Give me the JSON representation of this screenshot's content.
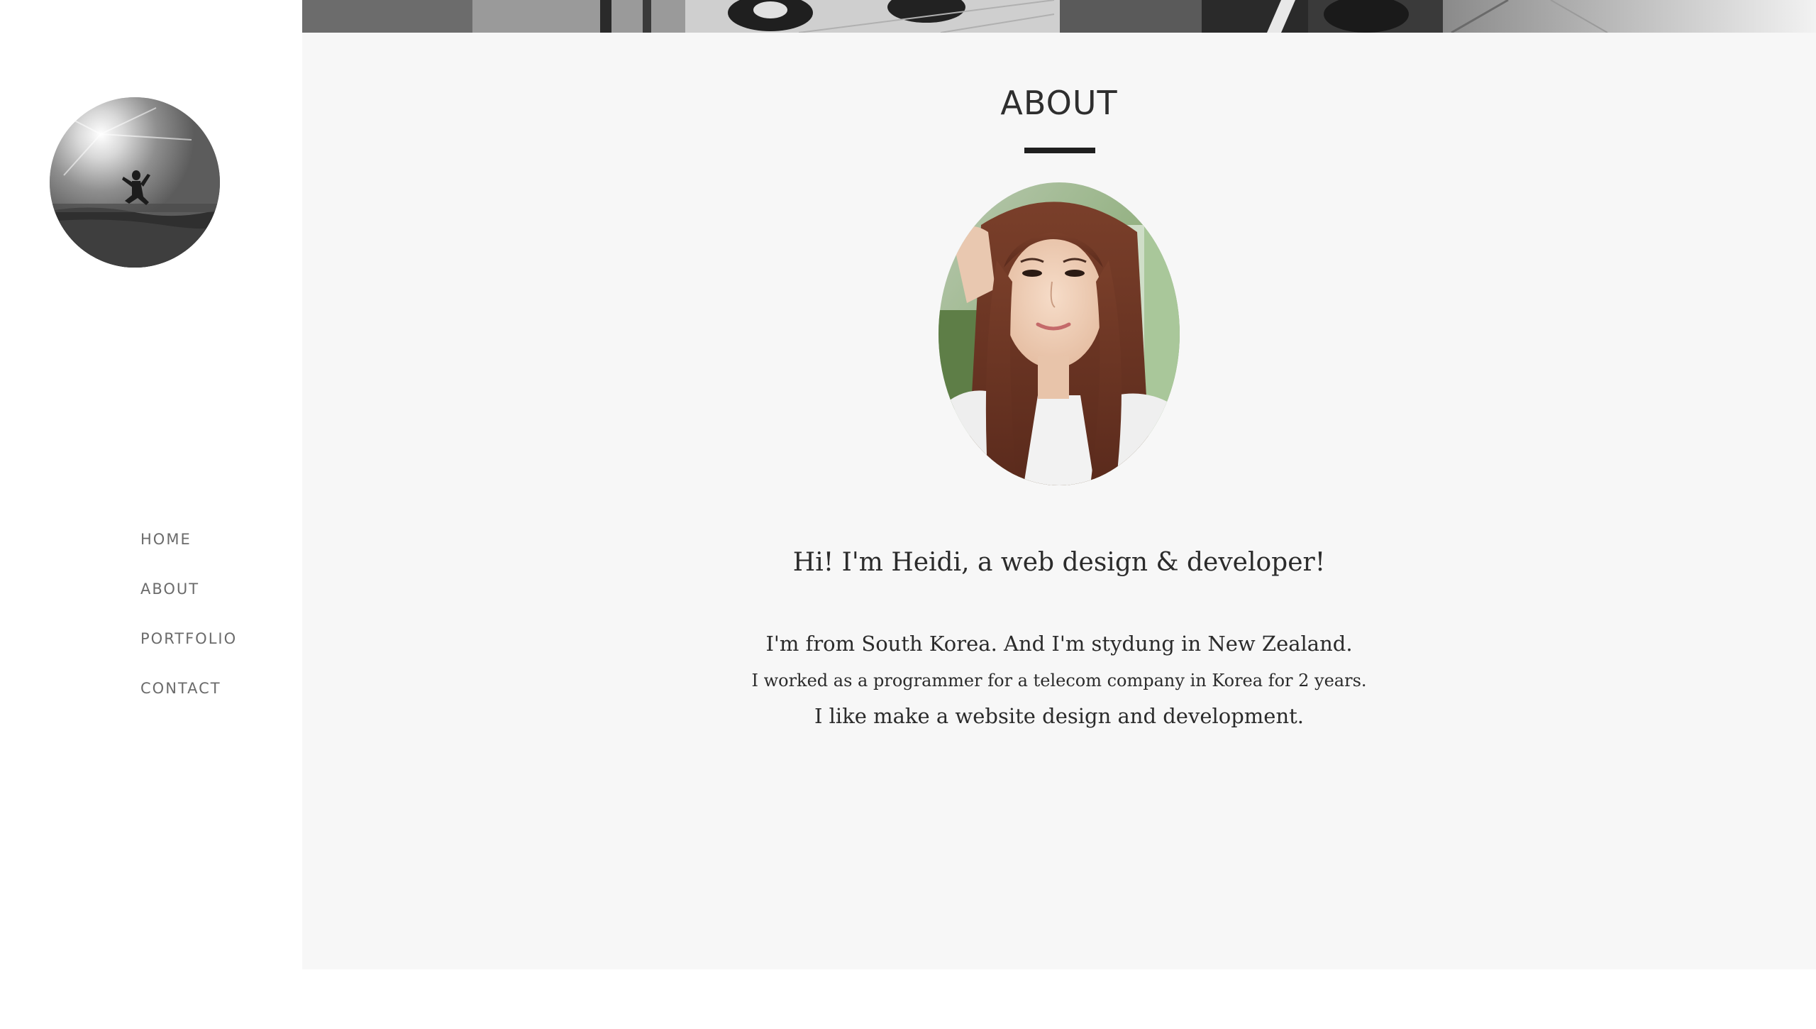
{
  "nav": {
    "items": [
      {
        "label": "HOME"
      },
      {
        "label": "ABOUT"
      },
      {
        "label": "PORTFOLIO"
      },
      {
        "label": "CONTACT"
      }
    ]
  },
  "about": {
    "title": "ABOUT",
    "headline": "Hi! I'm Heidi, a web design & developer!",
    "lines": [
      "I'm from South Korea. And I'm stydung in New Zealand.",
      "I worked as a programmer for a telecom company in Korea for 2 years.",
      "I like make a website design and development."
    ]
  },
  "colors": {
    "main_background": "#f7f7f7",
    "sidebar_background": "#ffffff",
    "nav_text": "#6b6b6b",
    "title_text": "#2e2e2e",
    "rule": "#1f1f1f"
  }
}
